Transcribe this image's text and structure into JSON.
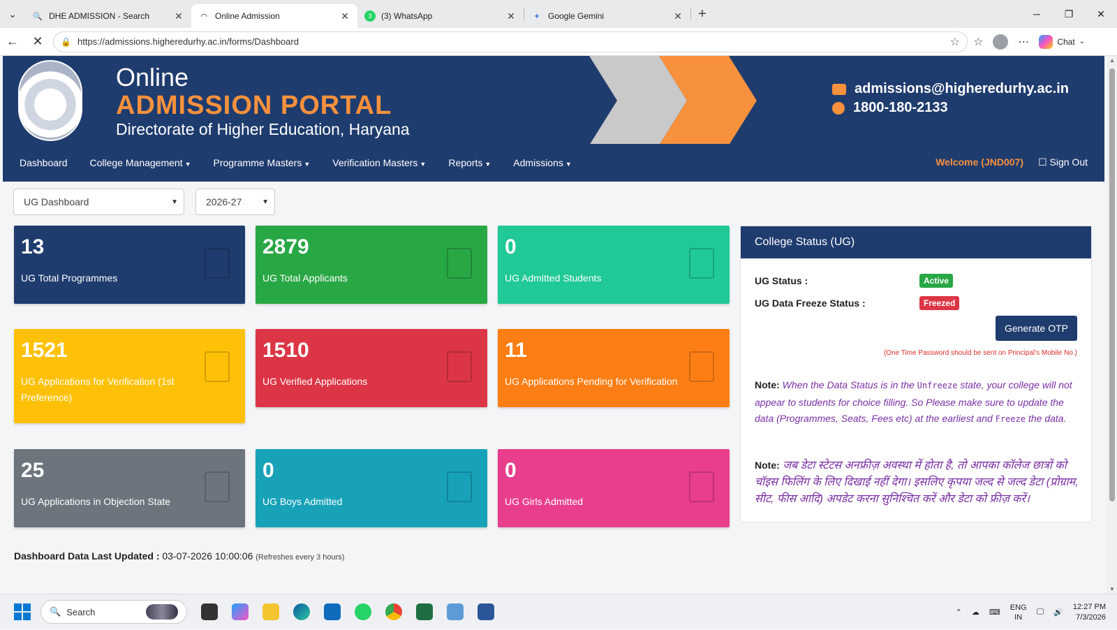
{
  "browser": {
    "tabs": [
      {
        "title": "DHE ADMISSION - Search",
        "icon": "search-icon"
      },
      {
        "title": "Online Admission",
        "icon": "loading-spinner-icon"
      },
      {
        "title": "(3) WhatsApp",
        "icon": "whatsapp-icon",
        "badge": "3"
      },
      {
        "title": "Google Gemini",
        "icon": "gemini-icon"
      }
    ],
    "url": "https://admissions.higheredurhy.ac.in/forms/Dashboard",
    "chat_label": "Chat"
  },
  "banner": {
    "line1": "Online",
    "line2": "ADMISSION PORTAL",
    "line3": "Directorate of Higher Education, Haryana",
    "email": "admissions@higheredurhy.ac.in",
    "phone": "1800-180-2133"
  },
  "nav": {
    "items": [
      {
        "label": "Dashboard",
        "dropdown": false
      },
      {
        "label": "College Management",
        "dropdown": true
      },
      {
        "label": "Programme Masters",
        "dropdown": true
      },
      {
        "label": "Verification Masters",
        "dropdown": true
      },
      {
        "label": "Reports",
        "dropdown": true
      },
      {
        "label": "Admissions",
        "dropdown": true
      }
    ],
    "welcome": "Welcome (JND007)",
    "signout": "Sign Out"
  },
  "filters": {
    "dashboard": "UG Dashboard",
    "session": "2026-27"
  },
  "cards": [
    {
      "value": "13",
      "label": "UG Total Programmes",
      "color": "#1f3c6e"
    },
    {
      "value": "2879",
      "label": "UG Total Applicants",
      "color": "#28a745"
    },
    {
      "value": "0",
      "label": "UG Admitted Students",
      "color": "#20c997"
    },
    {
      "value": "1521",
      "label": "UG Applications for Verification (1st Preference)",
      "color": "#ffc107"
    },
    {
      "value": "1510",
      "label": "UG Verified Applications",
      "color": "#dc3545"
    },
    {
      "value": "11",
      "label": "UG Applications Pending for Verification",
      "color": "#fd7e14"
    },
    {
      "value": "25",
      "label": "UG Applications in Objection State",
      "color": "#6c757d"
    },
    {
      "value": "0",
      "label": "UG Boys Admitted",
      "color": "#17a2b8"
    },
    {
      "value": "0",
      "label": "UG Girls Admitted",
      "color": "#e83e8c"
    }
  ],
  "status": {
    "title": "College Status (UG)",
    "ug_status_label": "UG Status :",
    "ug_status_value": "Active",
    "freeze_label": "UG Data Freeze Status :",
    "freeze_value": "Freezed",
    "otp_button": "Generate OTP",
    "otp_note": "(One Time Password should be sent on Principal's Mobile No.)",
    "note_label": "Note:",
    "note_en_1": "When the Data Status is in the",
    "note_en_unfreeze": "Unfreeze",
    "note_en_2": "state, your college will not appear to students for choice filling. So Please make sure to update the data (Programmes, Seats, Fees etc) at the earliest and",
    "note_en_freeze": "Freeze",
    "note_en_3": "the data.",
    "note_hi": "जब डेटा स्टेटस अनफ्रीज़ अवस्था में होता है, तो आपका कॉलेज छात्रों को चॉइस फिलिंग के लिए दिखाई नहीं देगा। इसलिए कृपया जल्द से जल्द डेटा (प्रोग्राम, सीट, फीस आदि) अपडेट करना सुनिश्चित करें और डेटा को फ्रीज़ करें।"
  },
  "last_updated": {
    "label": "Dashboard Data Last Updated :",
    "value": "03-07-2026 10:00:06",
    "note": "(Refreshes every 3 hours)"
  },
  "taskbar": {
    "search": "Search",
    "lang1": "ENG",
    "lang2": "IN",
    "time": "12:27 PM",
    "date": "7/3/2026"
  }
}
